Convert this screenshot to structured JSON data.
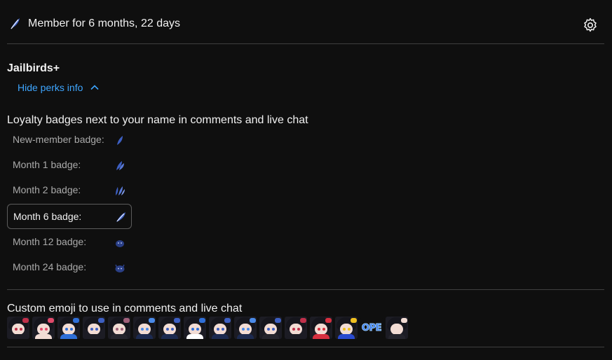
{
  "header": {
    "membership_text": "Member for 6 months, 22 days",
    "badge_icon": "feather-badge-icon",
    "settings_icon": "gear-icon"
  },
  "tier": {
    "name": "Jailbirds+",
    "toggle_label": "Hide perks info",
    "toggle_icon": "chevron-up-icon"
  },
  "loyalty": {
    "title": "Loyalty badges next to your name in comments and live chat",
    "badges": [
      {
        "label": "New-member badge:",
        "icon": "feather-single-icon",
        "selected": false
      },
      {
        "label": "Month 1 badge:",
        "icon": "feather-double-icon",
        "selected": false
      },
      {
        "label": "Month 2 badge:",
        "icon": "feather-triple-icon",
        "selected": false
      },
      {
        "label": "Month 6 badge:",
        "icon": "feather-quill-icon",
        "selected": true
      },
      {
        "label": "Month 12 badge:",
        "icon": "blob-creature-icon",
        "selected": false
      },
      {
        "label": "Month 24 badge:",
        "icon": "horned-creature-icon",
        "selected": false
      }
    ]
  },
  "emoji": {
    "title": "Custom emoji to use in comments and live chat",
    "items": [
      {
        "name": "emoji-1",
        "accent": "#c0304a",
        "body": "#1c1c24",
        "text": ""
      },
      {
        "name": "emoji-2",
        "accent": "#e04a6a",
        "body": "#f2dcd4",
        "text": ""
      },
      {
        "name": "emoji-3",
        "accent": "#2f6fd8",
        "body": "#2f6fd8",
        "text": ""
      },
      {
        "name": "emoji-4",
        "accent": "#3d5fc2",
        "body": "#1c1c24",
        "text": ""
      },
      {
        "name": "emoji-5",
        "accent": "#a0607a",
        "body": "#24242c",
        "text": ""
      },
      {
        "name": "emoji-6",
        "accent": "#4a8ae8",
        "body": "#1c2a50",
        "text": ""
      },
      {
        "name": "emoji-7",
        "accent": "#3d5fc2",
        "body": "#1c2a50",
        "text": ""
      },
      {
        "name": "emoji-8",
        "accent": "#2f6fd8",
        "body": "#ffffff",
        "text": ""
      },
      {
        "name": "emoji-9",
        "accent": "#3d5fc2",
        "body": "#1c2a50",
        "text": ""
      },
      {
        "name": "emoji-10",
        "accent": "#4a8ae8",
        "body": "#1c2a50",
        "text": ""
      },
      {
        "name": "emoji-11",
        "accent": "#3d5fc2",
        "body": "#24242c",
        "text": ""
      },
      {
        "name": "emoji-12",
        "accent": "#c0304a",
        "body": "#1c1c24",
        "text": ""
      },
      {
        "name": "emoji-13",
        "accent": "#d83040",
        "body": "#d83040",
        "text": ""
      },
      {
        "name": "emoji-14",
        "accent": "#f0c020",
        "body": "#2a4ad0",
        "text": ""
      },
      {
        "name": "emoji-15",
        "accent": "#2a6cf0",
        "body": "#0f0f0f",
        "text": "OPE"
      },
      {
        "name": "emoji-16",
        "accent": "#f2dcd4",
        "body": "#24242c",
        "text": ""
      }
    ]
  },
  "colors": {
    "background": "#0f0f0f",
    "link": "#3ea6ff",
    "badge_blue": "#3d5fc2",
    "divider": "#3f3f3f"
  }
}
